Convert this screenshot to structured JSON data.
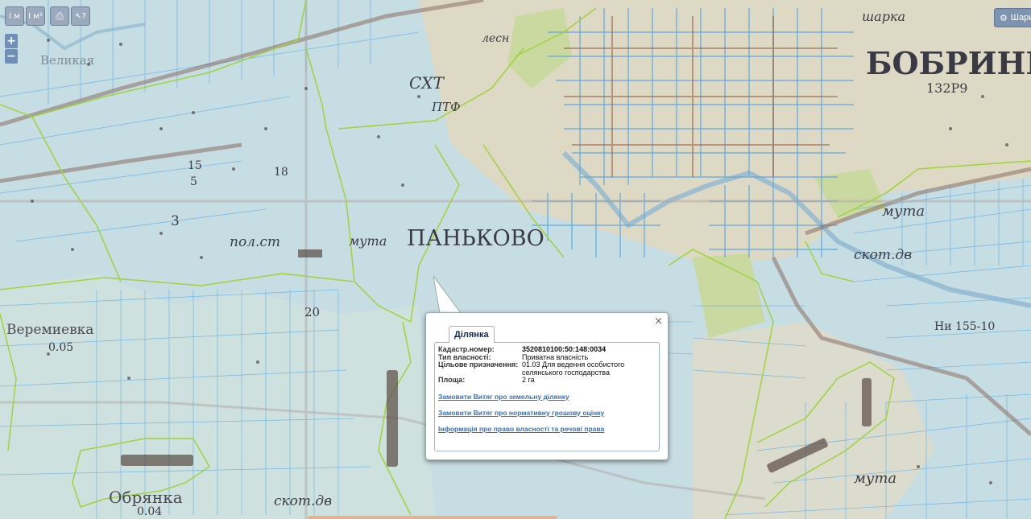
{
  "map": {
    "labels": [
      {
        "id": "bobrynets",
        "text": "БОБРИНЕЦ"
      },
      {
        "id": "pankovo",
        "text": "ПАНЬКОВО"
      },
      {
        "id": "veremievka",
        "text": "Веремиевка"
      },
      {
        "id": "obrianka",
        "text": "Обрянка"
      },
      {
        "id": "sht",
        "text": "СХТ"
      },
      {
        "id": "ptf",
        "text": "ПТФ"
      },
      {
        "id": "lesn",
        "text": "лесн"
      },
      {
        "id": "velikaya",
        "text": "Великая"
      },
      {
        "id": "polst",
        "text": "пол.ст"
      },
      {
        "id": "myta1",
        "text": "мута"
      },
      {
        "id": "myta2",
        "text": "мута"
      },
      {
        "id": "myta3",
        "text": "мута"
      },
      {
        "id": "skot1",
        "text": "скот.дв"
      },
      {
        "id": "skot2",
        "text": "скот.дв"
      },
      {
        "id": "sharka",
        "text": "шарка"
      },
      {
        "id": "n132",
        "text": "132Р9"
      },
      {
        "id": "n005",
        "text": "0.05"
      },
      {
        "id": "n004",
        "text": "0.04"
      },
      {
        "id": "n155",
        "text": "Ни 155-10"
      },
      {
        "id": "n20",
        "text": "20"
      },
      {
        "id": "n3",
        "text": "3"
      },
      {
        "id": "n15a",
        "text": "15"
      },
      {
        "id": "n15b",
        "text": "5"
      },
      {
        "id": "n18",
        "text": "18"
      }
    ],
    "colors": {
      "base": "#c9dfe4",
      "parcel_line": "#6ab4e8",
      "boundary": "#9fd33a",
      "road": "#9a6a4a",
      "forest": "#c9d9a0"
    }
  },
  "toolbar": {
    "buttons": [
      {
        "name": "ruler-tool-button",
        "icon": "ruler-icon",
        "text": "I м"
      },
      {
        "name": "area-tool-button",
        "icon": "area-icon",
        "text": "I м²"
      },
      {
        "name": "print-button",
        "icon": "printer-icon",
        "text": "⎙"
      },
      {
        "name": "identify-button",
        "icon": "cursor-question-icon",
        "text": "↖?"
      }
    ]
  },
  "zoom": {
    "in": "+",
    "out": "−"
  },
  "layers_button": {
    "label": "Шари",
    "icon": "gear-icon"
  },
  "popup": {
    "close": "×",
    "tab": "Ділянка",
    "fields": [
      {
        "k": "Кадастр.номер:",
        "v": "3520810100:50:148:0034",
        "bold": true
      },
      {
        "k": "Тип власності:",
        "v": "Приватна власність",
        "bold": false
      },
      {
        "k": "Цільове призначення:",
        "v": "01.03 Для ведення особистого селянського господарства",
        "bold": false
      },
      {
        "k": "Площа:",
        "v": "2 га",
        "bold": false
      }
    ],
    "links": [
      "Замовити Витяг про земельну ділянку",
      "Замовити Витяг про нормативну грошову оцінку",
      "Інформація про право власності та речові права"
    ]
  }
}
